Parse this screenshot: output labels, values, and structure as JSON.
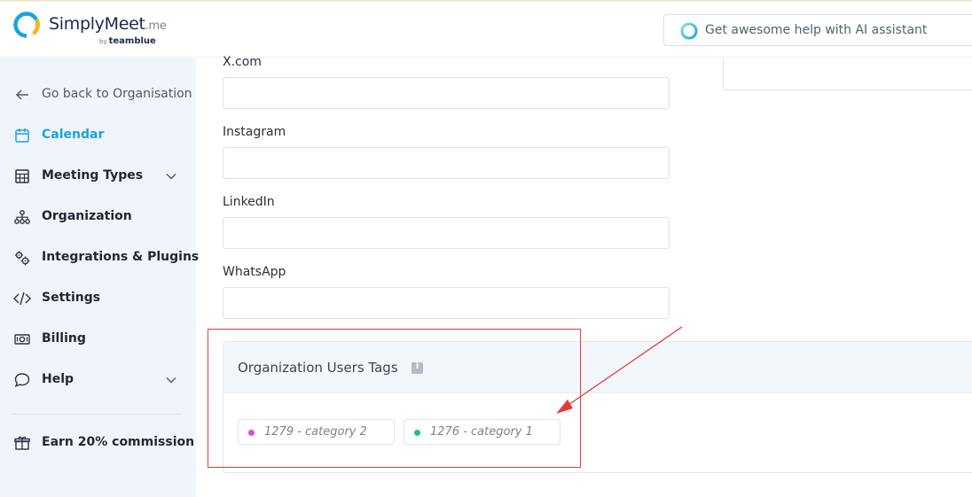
{
  "brand": {
    "name": "SimplyMeet",
    "suffix": ".me",
    "by": "by",
    "parent": "teamblue"
  },
  "ai_assistant": {
    "placeholder": "Get awesome help with AI assistant"
  },
  "sidebar": {
    "items": [
      {
        "label": "Go back to Organisation",
        "icon": "arrow-left-icon"
      },
      {
        "label": "Calendar",
        "icon": "calendar-icon",
        "active": true
      },
      {
        "label": "Meeting Types",
        "icon": "grid-calendar-icon",
        "expandable": true
      },
      {
        "label": "Organization",
        "icon": "org-chart-icon"
      },
      {
        "label": "Integrations & Plugins",
        "icon": "gears-icon"
      },
      {
        "label": "Settings",
        "icon": "code-icon"
      },
      {
        "label": "Billing",
        "icon": "cash-icon"
      },
      {
        "label": "Help",
        "icon": "chat-bubble-icon",
        "expandable": true
      }
    ],
    "commission": {
      "label": "Earn 20% commission",
      "icon": "gift-icon"
    }
  },
  "form": {
    "fields": [
      {
        "label": "X.com",
        "value": ""
      },
      {
        "label": "Instagram",
        "value": ""
      },
      {
        "label": "LinkedIn",
        "value": ""
      },
      {
        "label": "WhatsApp",
        "value": ""
      }
    ]
  },
  "tags_section": {
    "title": "Organization Users Tags",
    "info_icon": "i",
    "tags": [
      {
        "label": "1279 - category 2",
        "color": "#d84fcf"
      },
      {
        "label": "1276 - category 1",
        "color": "#1bc47d"
      }
    ]
  },
  "colors": {
    "accent": "#1aa4dc",
    "sidebar_bg": "#f0f5fb",
    "annotation": "#e53a3a"
  }
}
